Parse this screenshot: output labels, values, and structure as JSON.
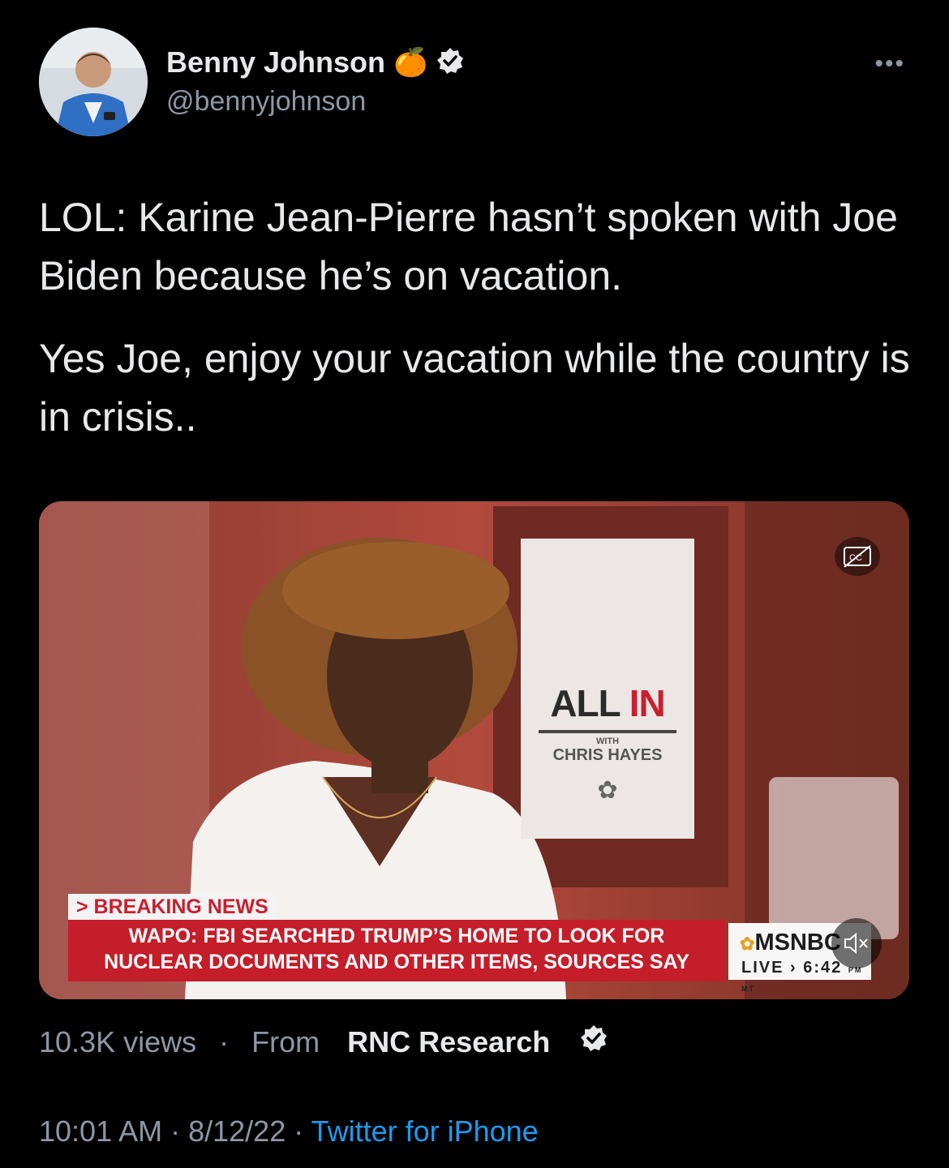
{
  "author": {
    "name": "Benny Johnson",
    "handle": "@bennyjohnson",
    "emoji": "🍊",
    "verified_icon": "verified-badge-icon"
  },
  "menu_icon": "more-options-icon",
  "tweet": {
    "paragraph1": "LOL: Karine Jean-Pierre hasn’t spoken with Joe Biden because he’s on vacation.",
    "paragraph2": "Yes Joe, enjoy your vacation while the country is in crisis.."
  },
  "video": {
    "show_title_part1": "ALL ",
    "show_title_part2": "IN",
    "show_with": "WITH",
    "show_host": "CHRIS HAYES",
    "breaking_tag": "> BREAKING NEWS",
    "headline_line1": "WAPO: FBI SEARCHED TRUMP’S HOME TO LOOK FOR",
    "headline_line2": "NUCLEAR DOCUMENTS AND OTHER ITEMS, SOURCES SAY",
    "network": "MSNBC",
    "live_label": "LIVE › 6:42",
    "time_suffix": "PM MT",
    "cc_icon": "closed-captions-icon",
    "mute_icon": "muted-speaker-icon"
  },
  "stats": {
    "views": "10.3K views",
    "separator": "·",
    "from_label": "From",
    "source": "RNC Research"
  },
  "footer": {
    "time": "10:01 AM",
    "date": "8/12/22",
    "separator": " · ",
    "client": "Twitter for iPhone"
  },
  "colors": {
    "background": "#000000",
    "text": "#e7e9ea",
    "secondary": "#8b98a5",
    "link": "#1d9bf0",
    "breaking_red": "#c41e2a"
  }
}
